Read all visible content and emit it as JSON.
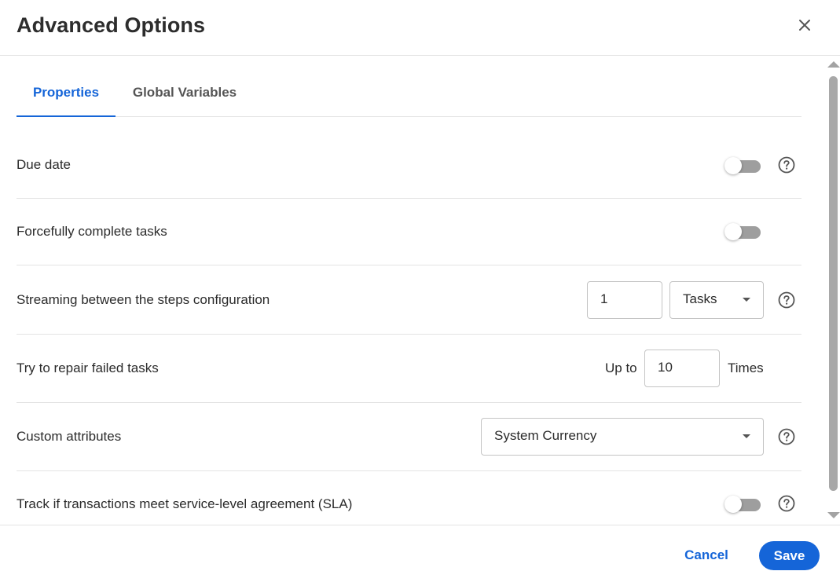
{
  "dialog": {
    "title": "Advanced Options"
  },
  "tabs": [
    {
      "label": "Properties",
      "active": true
    },
    {
      "label": "Global Variables",
      "active": false
    }
  ],
  "rows": {
    "due_date": {
      "label": "Due date",
      "toggle_on": false
    },
    "force_complete": {
      "label": "Forcefully complete tasks",
      "toggle_on": false
    },
    "streaming": {
      "label": "Streaming between the steps configuration",
      "value": "1",
      "unit": "Tasks"
    },
    "repair": {
      "label": "Try to repair failed tasks",
      "prefix": "Up to",
      "value": "10",
      "suffix": "Times"
    },
    "custom_attributes": {
      "label": "Custom attributes",
      "selected": "System Currency"
    },
    "sla": {
      "label": "Track if transactions meet service-level agreement (SLA)",
      "toggle_on": false
    }
  },
  "footer": {
    "cancel_label": "Cancel",
    "save_label": "Save"
  },
  "colors": {
    "accent": "#1565d8",
    "toggle_off_track": "#9e9e9e",
    "divider": "#e3e3e3"
  },
  "icons": [
    "close-icon",
    "help-circle-icon",
    "caret-down-icon"
  ]
}
